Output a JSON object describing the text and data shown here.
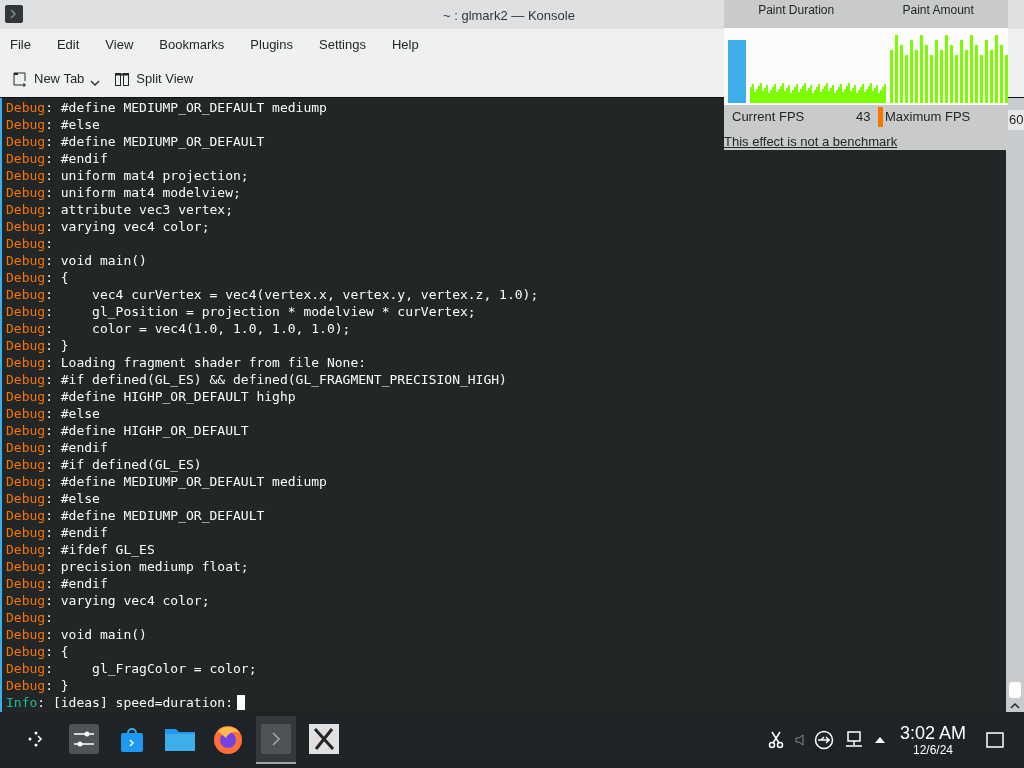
{
  "window": {
    "title": "~ : glmark2 — Konsole"
  },
  "menu": [
    "File",
    "Edit",
    "View",
    "Bookmarks",
    "Plugins",
    "Settings",
    "Help"
  ],
  "toolbar": [
    {
      "kind": "new-tab",
      "label": "New Tab"
    },
    {
      "kind": "split",
      "label": "Split View"
    }
  ],
  "terminal": {
    "lines": [
      {
        "kind": "debug",
        "tag": "Debug",
        "text": ": #define MEDIUMP_OR_DEFAULT mediump"
      },
      {
        "kind": "debug",
        "tag": "Debug",
        "text": ": #else"
      },
      {
        "kind": "debug",
        "tag": "Debug",
        "text": ": #define MEDIUMP_OR_DEFAULT"
      },
      {
        "kind": "debug",
        "tag": "Debug",
        "text": ": #endif"
      },
      {
        "kind": "debug",
        "tag": "Debug",
        "text": ": uniform mat4 projection;"
      },
      {
        "kind": "debug",
        "tag": "Debug",
        "text": ": uniform mat4 modelview;"
      },
      {
        "kind": "debug",
        "tag": "Debug",
        "text": ": attribute vec3 vertex;"
      },
      {
        "kind": "debug",
        "tag": "Debug",
        "text": ": varying vec4 color;"
      },
      {
        "kind": "debug",
        "tag": "Debug",
        "text": ":"
      },
      {
        "kind": "debug",
        "tag": "Debug",
        "text": ": void main()"
      },
      {
        "kind": "debug",
        "tag": "Debug",
        "text": ": {"
      },
      {
        "kind": "debug",
        "tag": "Debug",
        "text": ":     vec4 curVertex = vec4(vertex.x, vertex.y, vertex.z, 1.0);"
      },
      {
        "kind": "debug",
        "tag": "Debug",
        "text": ":     gl_Position = projection * modelview * curVertex;"
      },
      {
        "kind": "debug",
        "tag": "Debug",
        "text": ":     color = vec4(1.0, 1.0, 1.0, 1.0);"
      },
      {
        "kind": "debug",
        "tag": "Debug",
        "text": ": }"
      },
      {
        "kind": "debug",
        "tag": "Debug",
        "text": ": Loading fragment shader from file None:"
      },
      {
        "kind": "debug",
        "tag": "Debug",
        "text": ": #if defined(GL_ES) && defined(GL_FRAGMENT_PRECISION_HIGH)"
      },
      {
        "kind": "debug",
        "tag": "Debug",
        "text": ": #define HIGHP_OR_DEFAULT highp"
      },
      {
        "kind": "debug",
        "tag": "Debug",
        "text": ": #else"
      },
      {
        "kind": "debug",
        "tag": "Debug",
        "text": ": #define HIGHP_OR_DEFAULT"
      },
      {
        "kind": "debug",
        "tag": "Debug",
        "text": ": #endif"
      },
      {
        "kind": "debug",
        "tag": "Debug",
        "text": ": #if defined(GL_ES)"
      },
      {
        "kind": "debug",
        "tag": "Debug",
        "text": ": #define MEDIUMP_OR_DEFAULT mediump"
      },
      {
        "kind": "debug",
        "tag": "Debug",
        "text": ": #else"
      },
      {
        "kind": "debug",
        "tag": "Debug",
        "text": ": #define MEDIUMP_OR_DEFAULT"
      },
      {
        "kind": "debug",
        "tag": "Debug",
        "text": ": #endif"
      },
      {
        "kind": "debug",
        "tag": "Debug",
        "text": ": #ifdef GL_ES"
      },
      {
        "kind": "debug",
        "tag": "Debug",
        "text": ": precision mediump float;"
      },
      {
        "kind": "debug",
        "tag": "Debug",
        "text": ": #endif"
      },
      {
        "kind": "debug",
        "tag": "Debug",
        "text": ": varying vec4 color;"
      },
      {
        "kind": "debug",
        "tag": "Debug",
        "text": ":"
      },
      {
        "kind": "debug",
        "tag": "Debug",
        "text": ": void main()"
      },
      {
        "kind": "debug",
        "tag": "Debug",
        "text": ": {"
      },
      {
        "kind": "debug",
        "tag": "Debug",
        "text": ":     gl_FragColor = color;"
      },
      {
        "kind": "debug",
        "tag": "Debug",
        "text": ": }"
      },
      {
        "kind": "info",
        "tag": "Info",
        "text": ": [ideas] speed=duration:"
      }
    ]
  },
  "fps_overlay": {
    "labels": [
      "Paint Duration",
      "Paint Amount"
    ],
    "current_label": "Current FPS",
    "current_value": "43",
    "max_label": "Maximum FPS",
    "max_value": "60",
    "note": "This effect is not a benchmark"
  },
  "taskbar": {
    "apps": [
      {
        "kind": "launcher",
        "selected": false
      },
      {
        "kind": "settings",
        "selected": false
      },
      {
        "kind": "store",
        "selected": false
      },
      {
        "kind": "folder",
        "selected": false
      },
      {
        "kind": "browser",
        "selected": false
      },
      {
        "kind": "terminal",
        "selected": true
      },
      {
        "kind": "xapp",
        "selected": false
      }
    ],
    "tray": [
      {
        "kind": "scissors"
      },
      {
        "kind": "volume"
      },
      {
        "kind": "usb"
      },
      {
        "kind": "network"
      },
      {
        "kind": "expand"
      }
    ],
    "time": "3:02 AM",
    "date": "12/6/24"
  }
}
